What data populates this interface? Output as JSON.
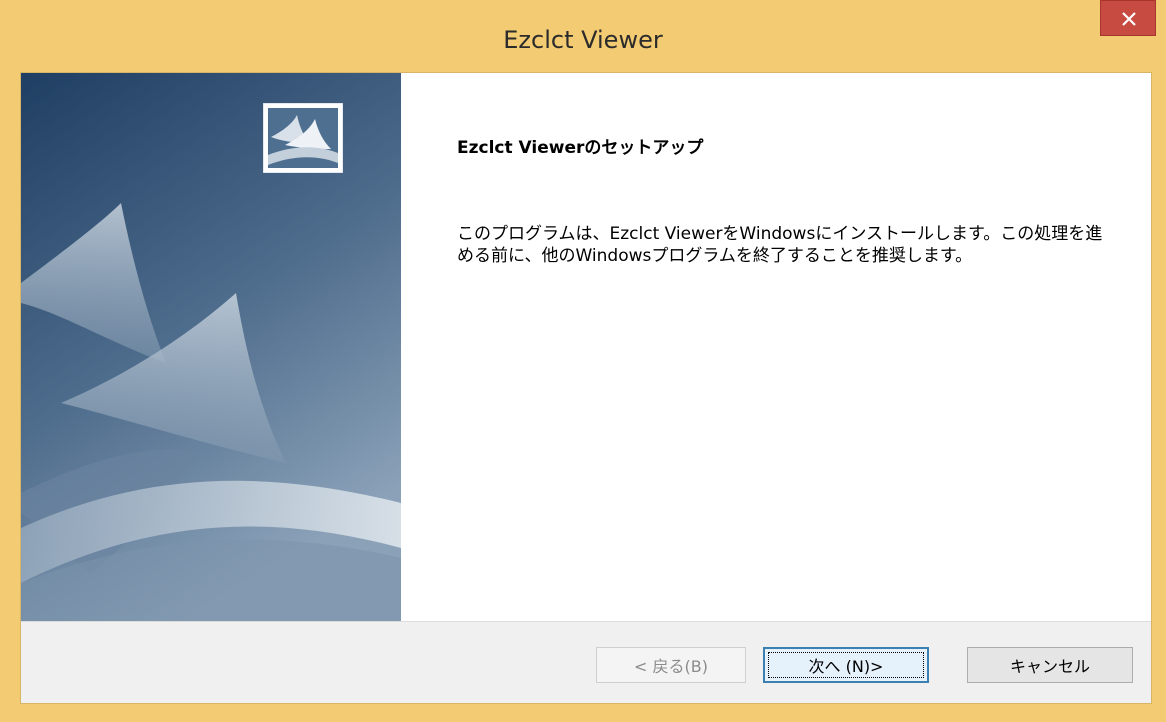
{
  "window": {
    "title": "Ezclct Viewer",
    "close_icon": "close-icon",
    "accent_color": "#f2cb72",
    "close_color": "#c74b41"
  },
  "banner": {
    "logo_icon": "setup-logo-icon",
    "gradient_top": "#1f3e63",
    "gradient_bottom": "#8aa1b8"
  },
  "main": {
    "heading": "Ezclct Viewerのセットアップ",
    "description": "このプログラムは、Ezclct ViewerをWindowsにインストールします。この処理を進める前に、他のWindowsプログラムを終了することを推奨します。"
  },
  "buttons": {
    "back_label": "< 戻る(B)",
    "next_label": "次へ (N)>",
    "cancel_label": "キャンセル"
  }
}
